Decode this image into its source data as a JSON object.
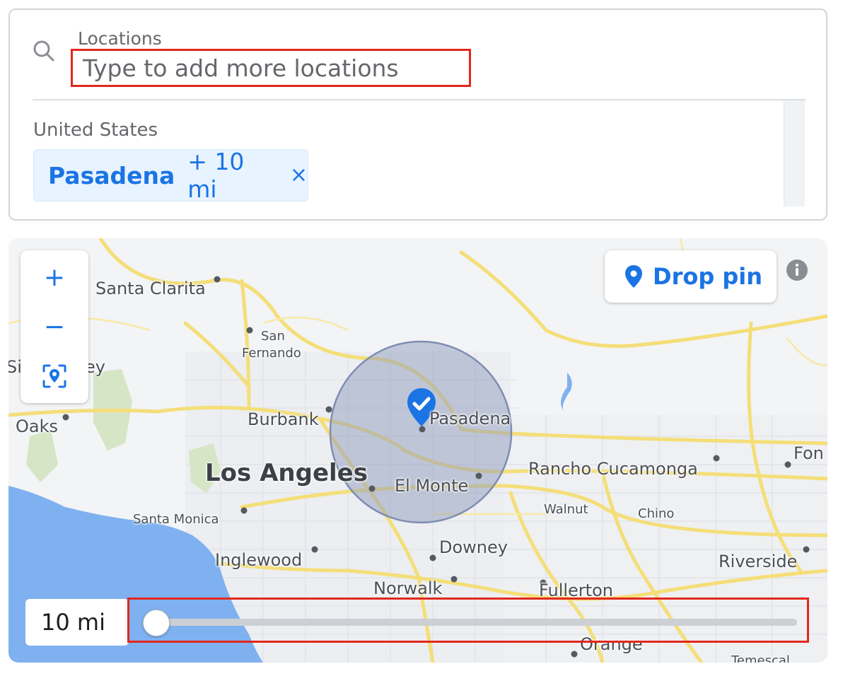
{
  "locations": {
    "label": "Locations",
    "placeholder": "Type to add more locations",
    "value": "",
    "country": "United States",
    "selected": [
      {
        "name": "Pasadena",
        "radius": "+ 10 mi",
        "remove": "×"
      }
    ]
  },
  "map": {
    "zoom_in": "+",
    "zoom_out": "−",
    "drop_pin_label": "Drop pin",
    "places": {
      "santa_clarita": "Santa Clarita",
      "san_fernando_1": "San",
      "san_fernando_2": "Fernando",
      "simi_valley_partial": "Si",
      "simi_valley_partial_2": "ey",
      "thousand_oaks_partial": "Oaks",
      "burbank": "Burbank",
      "pasadena": "Pasadena",
      "los_angeles": "Los Angeles",
      "el_monte": "El Monte",
      "rancho_cucamonga": "Rancho Cucamonga",
      "fontana_partial": "Fon",
      "walnut": "Walnut",
      "chino": "Chino",
      "santa_monica": "Santa Monica",
      "downey": "Downey",
      "inglewood": "Inglewood",
      "riverside": "Riverside",
      "norwalk": "Norwalk",
      "fullerton": "Fullerton",
      "orange_partial": "Orange",
      "temescal_partial": "Temescal"
    },
    "radius_text": "10 mi",
    "radius_slider_fraction": 0
  },
  "colors": {
    "accent": "#1b74e4",
    "highlight_box": "#e2281d",
    "ocean": "#7fb1f0",
    "road": "#f4de78",
    "circle_fill": "#8f9bbd"
  },
  "icons": {
    "search": "search-icon",
    "pin": "map-pin-icon",
    "locate": "locate-icon",
    "info": "info-icon",
    "check_pin": "check-pin-icon"
  }
}
